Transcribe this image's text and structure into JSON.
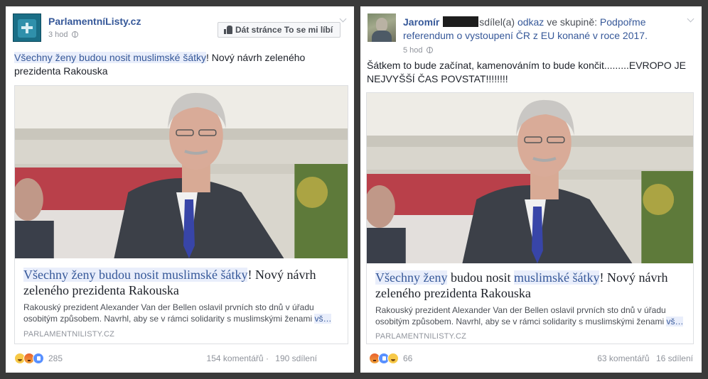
{
  "left_post": {
    "page_name": "ParlamentníListy.cz",
    "time": "3 hod",
    "like_page_button": "Dát stránce To se mi líbí",
    "text_highlight": "Všechny ženy budou nosit muslimské šátky",
    "text_rest": "! Nový návrh zeleného prezidenta Rakouska",
    "article": {
      "title_highlight": "Všechny ženy budou nosit muslimské šátky",
      "title_rest": "! Nový návrh zeleného prezidenta Rakouska",
      "description": "Rakouský prezident Alexander Van der Bellen oslavil prvních sto dnů v úřadu osobitým způsobem. Navrhl, aby se v rámci solidarity s muslimskými ženami",
      "more": "vš…",
      "domain": "PARLAMENTNILISTY.CZ"
    },
    "reactions_count": "285",
    "comments": "154 komentářů",
    "shares": "190 sdílení"
  },
  "right_post": {
    "author": "Jaromír",
    "shared_verb": "sdílel(a)",
    "shared_object": "odkaz",
    "in_group": "ve skupině:",
    "group_name": "Podpořme referendum o vystoupení ČR z EU konané v roce 2017.",
    "time": "5 hod",
    "text": "Šátkem to bude začínat, kamenováním to bude končit.........EVROPO JE NEJVYŠŠÍ ČAS POVSTAT!!!!!!!!",
    "article": {
      "title_a": "Všechny ženy",
      "title_b": " budou nosit ",
      "title_c": "muslimské šátky",
      "title_rest": "! Nový návrh zeleného prezidenta Rakouska",
      "description": "Rakouský prezident Alexander Van der Bellen oslavil prvních sto dnů v úřadu osobitým způsobem. Navrhl, aby se v rámci solidarity s muslimskými ženami",
      "more": "vš…",
      "domain": "PARLAMENTNILISTY.CZ"
    },
    "reactions_count": "66",
    "comments": "63 komentářů",
    "shares": "16 sdílení"
  },
  "colors": {
    "link": "#365899",
    "highlight_bg": "#e9eefb",
    "muted": "#90949c",
    "background": "#3a3a3a"
  }
}
